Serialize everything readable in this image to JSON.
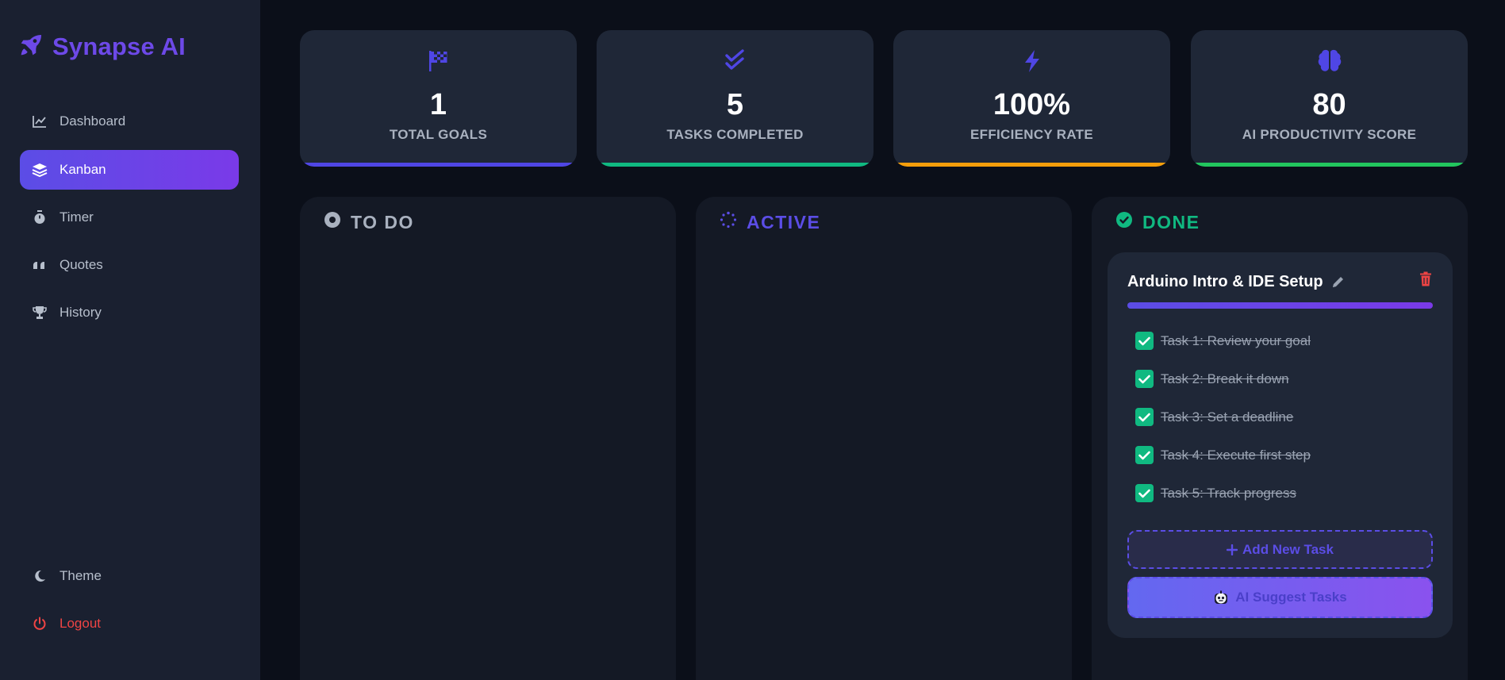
{
  "app": {
    "name": "Synapse AI",
    "brand_color": "#6d49e8"
  },
  "sidebar": {
    "items": [
      {
        "label": "Dashboard",
        "icon": "chart-line-icon"
      },
      {
        "label": "Kanban",
        "icon": "layers-icon",
        "active": true
      },
      {
        "label": "Timer",
        "icon": "stopwatch-icon"
      },
      {
        "label": "Quotes",
        "icon": "quote-icon"
      },
      {
        "label": "History",
        "icon": "trophy-icon"
      }
    ],
    "theme_label": "Theme",
    "logout_label": "Logout"
  },
  "stats": [
    {
      "value": "1",
      "label": "TOTAL GOALS",
      "icon": "flag-checkered-icon",
      "accent": "#4f46e5"
    },
    {
      "value": "5",
      "label": "TASKS COMPLETED",
      "icon": "double-check-icon",
      "accent": "#10b981"
    },
    {
      "value": "100%",
      "label": "EFFICIENCY RATE",
      "icon": "bolt-icon",
      "accent": "#f59e0b"
    },
    {
      "value": "80",
      "label": "AI PRODUCTIVITY SCORE",
      "icon": "brain-icon",
      "accent": "#22c55e"
    }
  ],
  "columns": {
    "todo": {
      "title": "TO DO",
      "color": "#a9b1bf"
    },
    "active": {
      "title": "ACTIVE",
      "color": "#5b4de6"
    },
    "done": {
      "title": "DONE",
      "color": "#10b981"
    }
  },
  "card": {
    "title": "Arduino Intro & IDE Setup",
    "progress": 1.0,
    "tasks": [
      {
        "label": "Task 1: Review your goal",
        "done": true
      },
      {
        "label": "Task 2: Break it down",
        "done": true
      },
      {
        "label": "Task 3: Set a deadline",
        "done": true
      },
      {
        "label": "Task 4: Execute first step",
        "done": true
      },
      {
        "label": "Task 5: Track progress",
        "done": true
      }
    ],
    "add_label": "Add New Task",
    "ai_label": "AI Suggest Tasks"
  }
}
